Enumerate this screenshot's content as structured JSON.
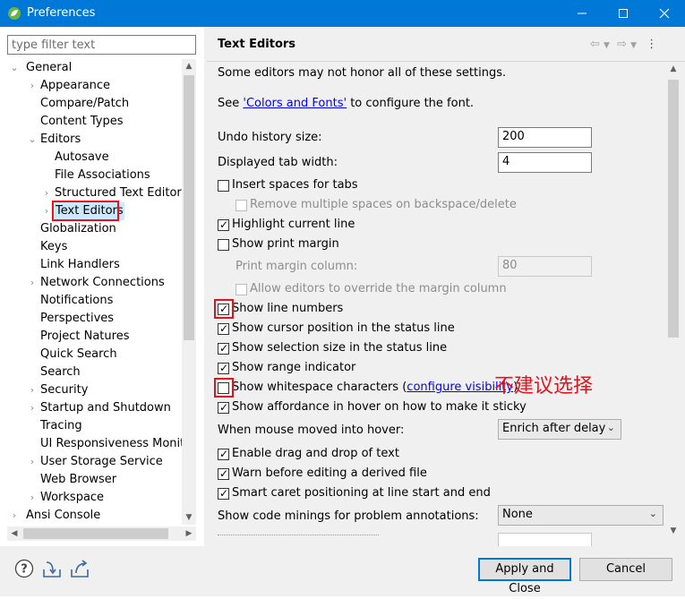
{
  "window": {
    "title": "Preferences"
  },
  "filter": {
    "placeholder": "type filter text"
  },
  "tree": {
    "general": "General",
    "appearance": "Appearance",
    "compare_patch": "Compare/Patch",
    "content_types": "Content Types",
    "editors": "Editors",
    "autosave": "Autosave",
    "file_associations": "File Associations",
    "structured_text_editors": "Structured Text Editors",
    "text_editors": "Text Editors",
    "globalization": "Globalization",
    "keys": "Keys",
    "link_handlers": "Link Handlers",
    "network_connections": "Network Connections",
    "notifications": "Notifications",
    "perspectives": "Perspectives",
    "project_natures": "Project Natures",
    "quick_search": "Quick Search",
    "search": "Search",
    "security": "Security",
    "startup_shutdown": "Startup and Shutdown",
    "tracing": "Tracing",
    "ui_responsiveness": "UI Responsiveness Monitor",
    "user_storage": "User Storage Service",
    "web_browser": "Web Browser",
    "workspace": "Workspace",
    "ansi_console": "Ansi Console"
  },
  "panel": {
    "title": "Text Editors",
    "note": "Some editors may not honor all of these settings.",
    "see_prefix": "See ",
    "see_link": "'Colors and Fonts'",
    "see_suffix": " to configure the font.",
    "undo_label": "Undo history size:",
    "undo_value": "200",
    "tab_label": "Displayed tab width:",
    "tab_value": "4",
    "insert_spaces": "Insert spaces for tabs",
    "remove_spaces": "Remove multiple spaces on backspace/delete",
    "highlight_line": "Highlight current line",
    "show_print_margin": "Show print margin",
    "print_margin_label": "Print margin column:",
    "print_margin_value": "80",
    "allow_override": "Allow editors to override the margin column",
    "show_line_numbers": "Show line numbers",
    "cursor_position": "Show cursor position in the status line",
    "selection_size": "Show selection size in the status line",
    "range_indicator": "Show range indicator",
    "whitespace_prefix": "Show whitespace characters (",
    "whitespace_link": "configure visibility",
    "whitespace_suffix": ")",
    "affordance_hover": "Show affordance in hover on how to make it sticky",
    "mouse_hover_label": "When mouse moved into hover:",
    "mouse_hover_value": "Enrich after delay",
    "drag_drop": "Enable drag and drop of text",
    "warn_derived": "Warn before editing a derived file",
    "smart_caret": "Smart caret positioning at line start and end",
    "code_minings_label": "Show code minings for problem annotations:",
    "code_minings_value": "None"
  },
  "annotation": {
    "text": "不建议选择"
  },
  "buttons": {
    "apply_close": "Apply and Close",
    "cancel": "Cancel"
  },
  "colors": {
    "titlebar": "#0078d7",
    "annotation": "#e8101a",
    "link": "#0000ff"
  }
}
